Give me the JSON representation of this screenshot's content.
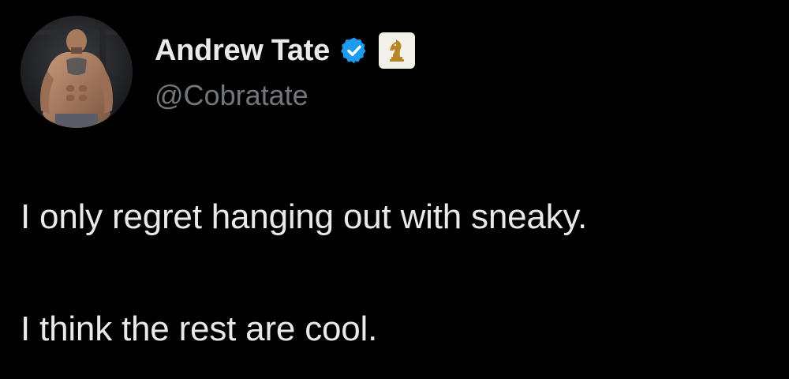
{
  "author": {
    "display_name": "Andrew Tate",
    "handle": "@Cobratate",
    "verified": true,
    "avatar_icon": "avatar-photo",
    "badge_icons": [
      "verified-badge-icon",
      "chess-knight-icon"
    ]
  },
  "tweet": {
    "line_1": "I only regret hanging out with sneaky.",
    "line_2": "I think the rest are cool."
  },
  "colors": {
    "background": "#000000",
    "text": "#e7e9ea",
    "handle": "#71767b",
    "verified": "#1d9bf0",
    "affiliate_badge_bg": "#f3f0ea",
    "affiliate_badge_icon": "#b8862a"
  }
}
